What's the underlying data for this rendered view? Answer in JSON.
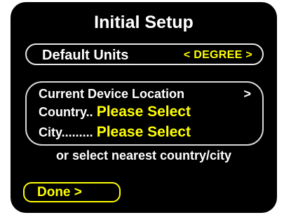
{
  "title": "Initial Setup",
  "units": {
    "label": "Default Units",
    "value": "< DEGREE >"
  },
  "location": {
    "current_label": "Current Device Location",
    "current_arrow": ">",
    "country_label": "Country..",
    "country_value": "Please Select",
    "city_label": "City.........",
    "city_value": "Please Select"
  },
  "hint": "or select nearest country/city",
  "done_label": "Done  >",
  "colors": {
    "background": "#000000",
    "text": "#ffffff",
    "accent": "#ffff00"
  }
}
